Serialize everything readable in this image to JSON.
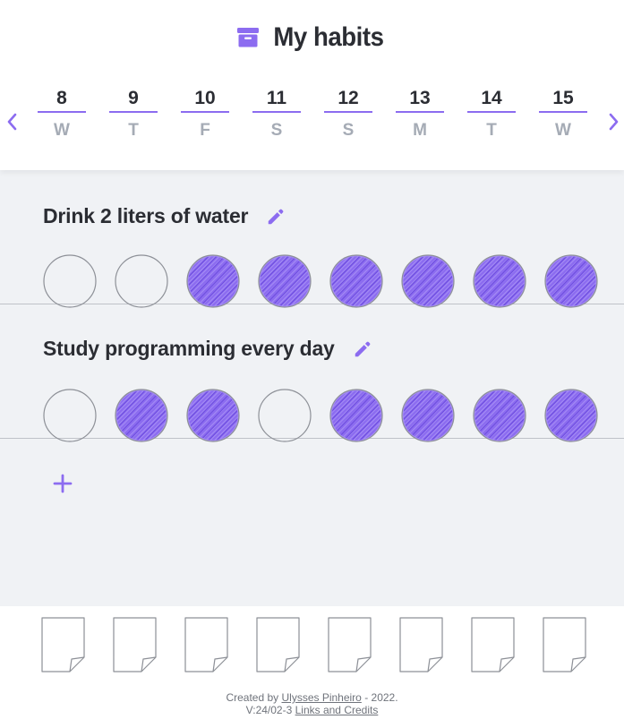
{
  "app": {
    "title": "My habits",
    "accent_color": "#8c6cf0",
    "title_icon": "archive-box-icon"
  },
  "navigation": {
    "prev_icon": "chevron-left-icon",
    "next_icon": "chevron-right-icon"
  },
  "days": [
    {
      "number": "8",
      "letter": "W"
    },
    {
      "number": "9",
      "letter": "T"
    },
    {
      "number": "10",
      "letter": "F"
    },
    {
      "number": "11",
      "letter": "S"
    },
    {
      "number": "12",
      "letter": "S"
    },
    {
      "number": "13",
      "letter": "M"
    },
    {
      "number": "14",
      "letter": "T"
    },
    {
      "number": "15",
      "letter": "W"
    }
  ],
  "habits": [
    {
      "name": "Drink 2 liters of water",
      "done": [
        false,
        false,
        true,
        true,
        true,
        true,
        true,
        true
      ]
    },
    {
      "name": "Study programming every day",
      "done": [
        false,
        true,
        true,
        false,
        true,
        true,
        true,
        true
      ]
    }
  ],
  "add_button_icon": "plus-icon",
  "notes_icon": "note-page-icon",
  "footer": {
    "created_by_prefix": "Created by",
    "author_name": "Ulysses Pinheiro",
    "created_by_suffix": "- 2022.",
    "version": "V:24/02-3",
    "links_label": "Links and Credits"
  }
}
